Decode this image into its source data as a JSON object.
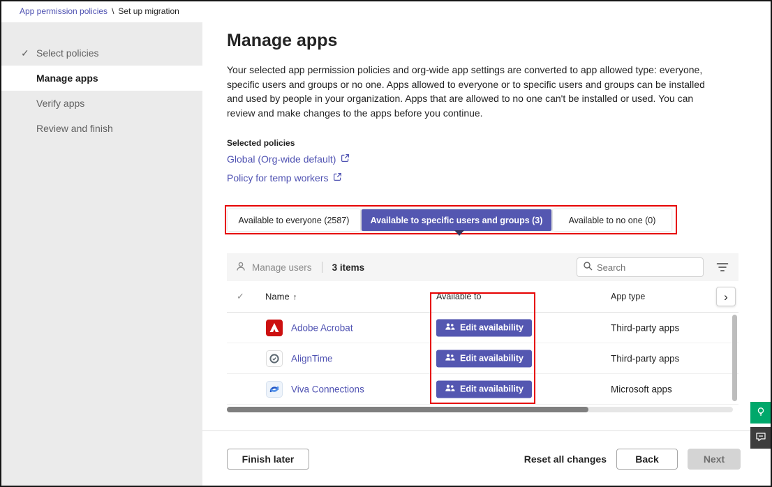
{
  "breadcrumb": {
    "parent": "App permission policies",
    "separator": "\\",
    "current": "Set up migration"
  },
  "sidebar": {
    "items": [
      {
        "label": "Select policies"
      },
      {
        "label": "Manage apps"
      },
      {
        "label": "Verify apps"
      },
      {
        "label": "Review and finish"
      }
    ]
  },
  "main": {
    "title": "Manage apps",
    "description": "Your selected app permission policies and org-wide app settings are converted to app allowed type: everyone, specific users and groups or no one. Apps allowed to everyone or to specific users and groups can be installed and used by people in your organization. Apps that are allowed to no one can't be installed or used. You can review and make changes to the apps before you continue.",
    "selected_policies_label": "Selected policies",
    "policies": [
      {
        "label": "Global (Org-wide default)"
      },
      {
        "label": "Policy for temp workers"
      }
    ],
    "tabs": [
      {
        "label": "Available to everyone (2587)",
        "active": false
      },
      {
        "label": "Available to specific users and groups (3)",
        "active": true
      },
      {
        "label": "Available to no one (0)",
        "active": false
      }
    ]
  },
  "table": {
    "toolbar": {
      "manage_users_label": "Manage users",
      "items_count": "3 items",
      "search_placeholder": "Search"
    },
    "columns": {
      "name": "Name",
      "available_to": "Available to",
      "app_type": "App type"
    },
    "rows": [
      {
        "name": "Adobe Acrobat",
        "available_to": "Edit availability",
        "app_type": "Third-party apps"
      },
      {
        "name": "AlignTime",
        "available_to": "Edit availability",
        "app_type": "Third-party apps"
      },
      {
        "name": "Viva Connections",
        "available_to": "Edit availability",
        "app_type": "Microsoft apps"
      }
    ]
  },
  "footer": {
    "finish_later": "Finish later",
    "reset_all": "Reset all changes",
    "back": "Back",
    "next": "Next"
  },
  "icons": {
    "check": "✓",
    "sort_asc": "↑",
    "chevron_right": "›"
  },
  "colors": {
    "accent": "#5457b1",
    "link": "#4f52b2",
    "annotation": "#e60000",
    "feedback_green": "#00a86b",
    "feedback_dark": "#3d3d3d"
  }
}
